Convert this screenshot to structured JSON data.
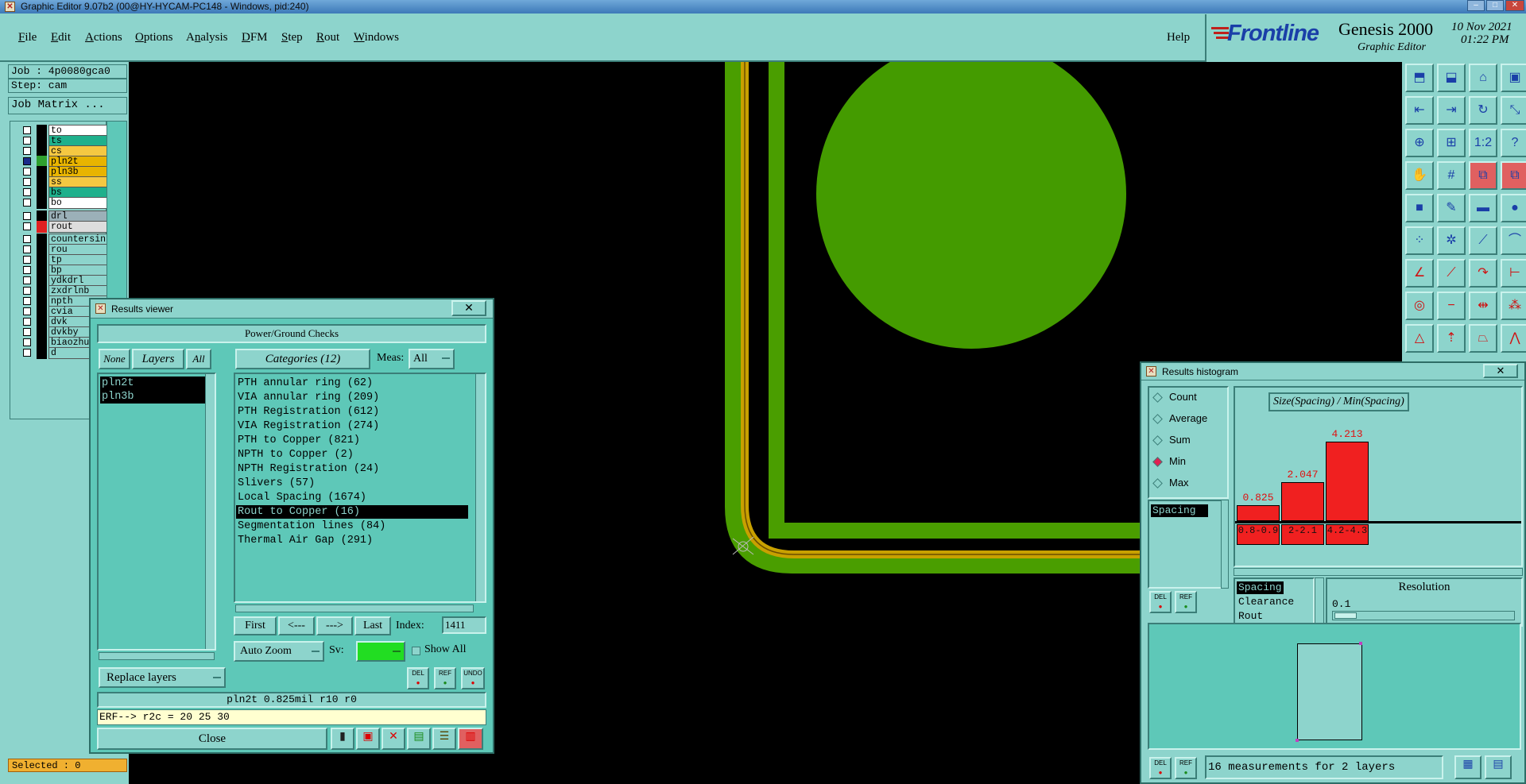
{
  "window": {
    "title": "Graphic Editor 9.07b2 (00@HY-HYCAM-PC148 - Windows, pid:240)"
  },
  "menu": {
    "items": [
      "File",
      "Edit",
      "Actions",
      "Options",
      "Analysis",
      "DFM",
      "Step",
      "Rout",
      "Windows"
    ],
    "help": "Help"
  },
  "brand": {
    "name": "Frontline",
    "product": "Genesis 2000",
    "subtitle": "Graphic Editor",
    "date": "10 Nov 2021",
    "time": "01:22 PM"
  },
  "left_panel": {
    "job": "Job : 4p0080gca0",
    "step": "Step: cam",
    "job_matrix": "Job Matrix ...",
    "layers_group1": [
      {
        "name": "to",
        "color": "#ffffff"
      },
      {
        "name": "ts",
        "color": "#1fb08c"
      },
      {
        "name": "cs",
        "color": "#f5c842"
      },
      {
        "name": "pln2t",
        "color": "#e8b400"
      },
      {
        "name": "pln3b",
        "color": "#e8b400"
      },
      {
        "name": "ss",
        "color": "#f5c842"
      },
      {
        "name": "bs",
        "color": "#1fb08c"
      },
      {
        "name": "bo",
        "color": "#ffffff"
      }
    ],
    "layers_group2": [
      {
        "name": "drl",
        "color": "#9bb0b8"
      },
      {
        "name": "rout",
        "color": "#dddddd"
      }
    ],
    "layers_group3": [
      "countersink",
      "rou",
      "tp",
      "bp",
      "ydkdrl",
      "zxdrlnb",
      "npth",
      "cvia",
      "dvk",
      "dvkby",
      "biaozhu",
      "d"
    ],
    "selected": "Selected : 0"
  },
  "results_viewer": {
    "title": "Results viewer",
    "header": "Power/Ground Checks",
    "none_btn": "None",
    "layers_btn": "Layers",
    "all_btn": "All",
    "categories_btn": "Categories (12)",
    "meas_label": "Meas:",
    "meas_value": "All",
    "layers": [
      "pln2t",
      "pln3b"
    ],
    "categories": [
      "PTH annular ring (62)",
      "VIA annular ring (209)",
      "PTH Registration (612)",
      "VIA Registration (274)",
      "PTH to Copper (821)",
      "NPTH to Copper (2)",
      "NPTH Registration (24)",
      "Slivers (57)",
      "Local Spacing (1674)",
      "Rout to Copper (16)",
      "Segmentation lines (84)",
      "Thermal Air Gap (291)"
    ],
    "selected_category": "Rout to Copper (16)",
    "first": "First",
    "prev": "<---",
    "next": "--->",
    "last": "Last",
    "index_label": "Index:",
    "index_value": "1411",
    "auto_zoom": "Auto Zoom",
    "sv_label": "Sv:",
    "show_all": "Show All",
    "replace_layers": "Replace layers",
    "del": "DEL",
    "ref": "REF",
    "undo": "UNDO",
    "status": "pln2t 0.825mil  r10  r0",
    "erf": "ERF--> r2c = 20 25 30",
    "close": "Close"
  },
  "histogram": {
    "title": "Results histogram",
    "options": [
      "Count",
      "Average",
      "Sum",
      "Min",
      "Max"
    ],
    "selected_option": "Min",
    "measure_list": [
      "Spacing"
    ],
    "chart_title": "Size(Spacing) / Min(Spacing)",
    "bars": [
      {
        "value": "0.825",
        "range": "0.8-0.9",
        "ratio": 0.196
      },
      {
        "value": "2.047",
        "range": "2-2.1",
        "ratio": 0.486
      },
      {
        "value": "4.213",
        "range": "4.2-4.3",
        "ratio": 1.0
      }
    ],
    "measures": [
      "Spacing",
      "Clearance",
      "Rout"
    ],
    "resolution_label": "Resolution",
    "resolution_value": "0.1",
    "del": "DEL",
    "ref": "REF",
    "summary": "16 measurements for 2 layers"
  }
}
